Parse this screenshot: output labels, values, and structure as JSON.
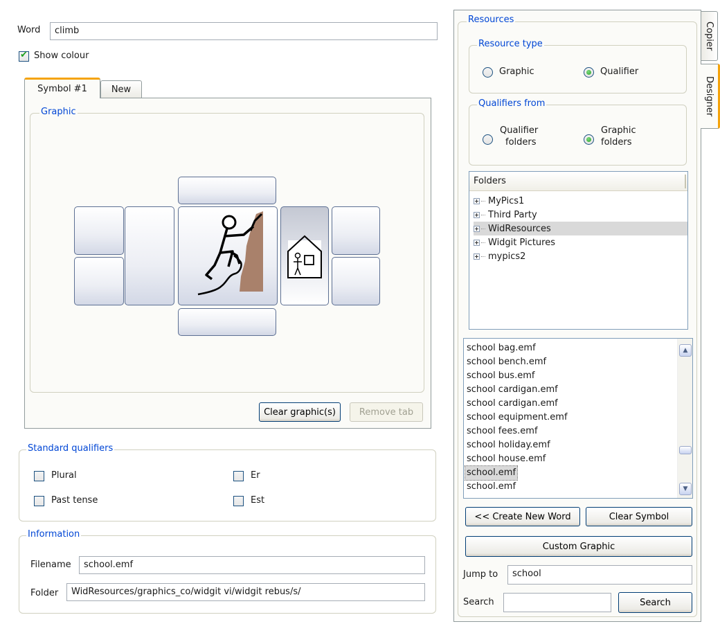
{
  "word": {
    "label": "Word",
    "value": "climb"
  },
  "show_colour": {
    "label": "Show colour",
    "checked": true
  },
  "tabs": [
    {
      "label": "Symbol #1",
      "active": true
    },
    {
      "label": "New",
      "active": false
    }
  ],
  "graphic": {
    "title": "Graphic",
    "clear_button": "Clear graphic(s)",
    "remove_button": "Remove tab"
  },
  "standard_qualifiers": {
    "title": "Standard qualifiers",
    "items": [
      {
        "label": "Plural",
        "checked": false
      },
      {
        "label": "Er",
        "checked": false
      },
      {
        "label": "Past tense",
        "checked": false
      },
      {
        "label": "Est",
        "checked": false
      }
    ]
  },
  "information": {
    "title": "Information",
    "filename_label": "Filename",
    "filename_value": "school.emf",
    "folder_label": "Folder",
    "folder_value": "WidResources/graphics_co/widgit vi/widgit rebus/s/"
  },
  "resources": {
    "title": "Resources",
    "resource_type": {
      "title": "Resource type",
      "options": [
        {
          "label": "Graphic",
          "selected": false
        },
        {
          "label": "Qualifier",
          "selected": true
        }
      ]
    },
    "qualifiers_from": {
      "title": "Qualifiers from",
      "options": [
        {
          "line1": "Qualifier",
          "line2": "folders",
          "selected": false
        },
        {
          "line1": "Graphic",
          "line2": "folders",
          "selected": true
        }
      ]
    },
    "folders": {
      "header": "Folders",
      "items": [
        "MyPics1",
        "Third Party",
        "WidResources",
        "Widgit Pictures",
        "mypics2"
      ],
      "selected_index": 2
    },
    "files": {
      "items": [
        "school bag.emf",
        "school bench.emf",
        "school bus.emf",
        "school cardigan.emf",
        "school cardigan.emf",
        "school equipment.emf",
        "school fees.emf",
        "school holiday.emf",
        "school house.emf",
        "school.emf",
        "school.emf"
      ],
      "selected_index": 9
    },
    "create_new_word": "<< Create New Word",
    "clear_symbol": "Clear Symbol",
    "custom_graphic": "Custom Graphic",
    "jump_to_label": "Jump to",
    "jump_to_value": "school",
    "search_label": "Search",
    "search_value": "",
    "search_button": "Search"
  },
  "side_tabs": [
    {
      "label": "Copier",
      "active": false
    },
    {
      "label": "Designer",
      "active": true
    }
  ],
  "colors": {
    "accent_title": "#0046d5",
    "tab_active_line": "#f5a30a",
    "tree_selected": "#d9d9d9"
  }
}
